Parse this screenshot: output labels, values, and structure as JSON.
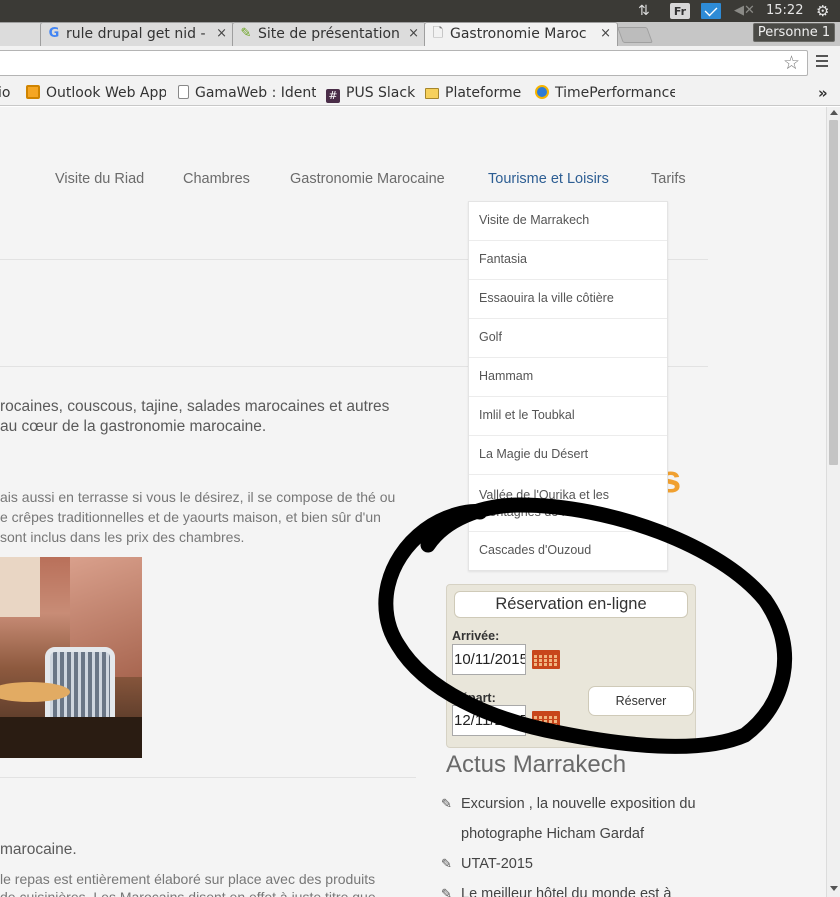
{
  "os_bar": {
    "keyboard_layout": "Fr",
    "time": "15:22"
  },
  "tabs": [
    {
      "title": "",
      "close": "×",
      "favicon": "page-icon"
    },
    {
      "title": "rule drupal get nid -",
      "close": "×",
      "favicon": "google-icon"
    },
    {
      "title": "Site de présentation",
      "close": "×",
      "favicon": "drupal-icon"
    },
    {
      "title": "Gastronomie Maroc",
      "close": "×",
      "favicon": "page-icon",
      "active": true
    }
  ],
  "profile": "Personne 1",
  "url": {
    "value": ""
  },
  "bookmarks": [
    {
      "label": "io",
      "icon": "page-icon"
    },
    {
      "label": "Outlook Web App",
      "icon": "outlook-icon"
    },
    {
      "label": "GamaWeb : Ident",
      "icon": "page-icon"
    },
    {
      "label": "PUS Slack",
      "icon": "slack-icon"
    },
    {
      "label": "Plateforme",
      "icon": "folder-icon"
    },
    {
      "label": "TimePerformance",
      "icon": "timeperformance-icon"
    }
  ],
  "bookmarks_more": "»",
  "nav": [
    {
      "label": "Visite du Riad"
    },
    {
      "label": "Chambres"
    },
    {
      "label": "Gastronomie Marocaine"
    },
    {
      "label": "Tourisme et Loisirs",
      "active": true
    },
    {
      "label": "Tarifs"
    }
  ],
  "dropdown": [
    "Visite de Marrakech",
    "Fantasia",
    "Essaouira la ville côtière",
    "Golf",
    "Hammam",
    "Imlil et le Toubkal",
    "La Magie du Désert",
    "Vallée de l'Ourika et les Montagnes de l'Atlas",
    "Cascades d'Ouzoud"
  ],
  "content": {
    "intro_line1": "rocaines, couscous, tajine, salades marocaines et autres",
    "intro_line2": "au cœur de la gastronomie marocaine.",
    "breakfast_line1": "ais aussi en terrasse si vous le désirez, il se compose de thé ou",
    "breakfast_line2": "e crêpes traditionnelles et de yaourts maison, et bien sûr d'un",
    "breakfast_line3": "sont inclus dans les prix des chambres.",
    "section_heading": "marocaine.",
    "section_line1": "le repas est entièrement élaboré sur place avec des produits",
    "section_line2": "de cuisinières. Les Marocains disent en effet à juste titre que"
  },
  "orange_title_fragment": "s",
  "reservation": {
    "title": "Réservation en-ligne",
    "arrivee_label": "Arrivée:",
    "arrivee_value": "10/11/2015",
    "depart_label": "Départ:",
    "depart_value": "12/11/2015",
    "submit": "Réserver"
  },
  "actus": {
    "title": "Actus Marrakech",
    "items": [
      "Excursion , la nouvelle exposition du photographe Hicham Gardaf",
      "UTAT-2015",
      "Le meilleur hôtel du monde est à"
    ]
  },
  "colors": {
    "nav_active": "#2d5e93",
    "orange_title": "#f0a030",
    "annotation": "#000000"
  }
}
